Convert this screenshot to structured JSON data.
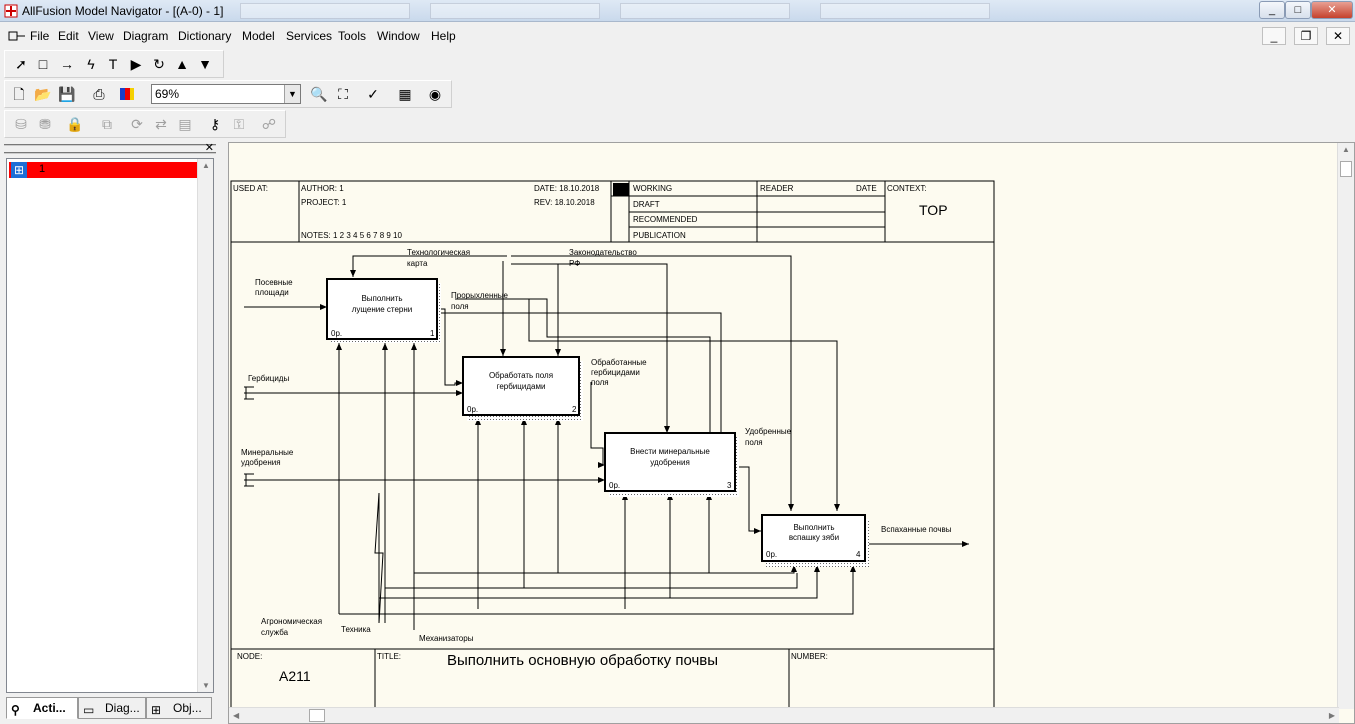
{
  "window": {
    "title": "AllFusion Model Navigator - [(A-0)  - 1]",
    "minimize": "_",
    "maximize": "□",
    "close": "✕"
  },
  "menu": [
    "File",
    "Edit",
    "View",
    "Diagram",
    "Dictionary",
    "Model",
    "Services",
    "Tools",
    "Window",
    "Help"
  ],
  "mdi_controls": {
    "minimize": "_",
    "restore": "❐",
    "close": "✕"
  },
  "toolbar": {
    "zoom_value": "69%"
  },
  "tree": {
    "root_label": "1"
  },
  "left_tabs": [
    "Acti...",
    "Diag...",
    "Obj..."
  ],
  "diagram": {
    "header": {
      "used_at": "USED AT:",
      "author": "AUTHOR:  1",
      "project": "PROJECT:  1",
      "notes": "NOTES:  1  2  3  4  5  6  7  8  9  10",
      "date": "DATE:  18.10.2018",
      "rev": "REV:   18.10.2018",
      "working": "WORKING",
      "draft": "DRAFT",
      "recommended": "RECOMMENDED",
      "publication": "PUBLICATION",
      "reader": "READER",
      "date2": "DATE",
      "context": "CONTEXT:",
      "top": "TOP"
    },
    "boxes": [
      {
        "label1": "Выполнить",
        "label2": "лущение стерни",
        "cost": "0р.",
        "num": "1"
      },
      {
        "label1": "Обработать поля",
        "label2": "гербицидами",
        "cost": "0р.",
        "num": "2"
      },
      {
        "label1": "Внести минеральные",
        "label2": "удобрения",
        "cost": "0р.",
        "num": "3"
      },
      {
        "label1": "Выполнить",
        "label2": "вспашку зяби",
        "cost": "0р.",
        "num": "4"
      }
    ],
    "arrows": {
      "posevnye1": "Посевные",
      "posevnye2": "площади",
      "gerbicidy": "Гербициды",
      "mineralnye1": "Минеральные",
      "mineralnye2": "удобрения",
      "tech1": "Технологическая",
      "tech2": "карта",
      "zakon1": "Законодательство",
      "zakon2": "РФ",
      "propol1": "Прорыхленные",
      "propol2": "поля",
      "obrab1": "Обработанные",
      "obrab2": "гербицидами",
      "obrab3": "поля",
      "udobr1": "Удобренные",
      "udobr2": "поля",
      "vspah": "Вспаханные почвы",
      "agro1": "Агрономическая",
      "agro2": "служба",
      "tehnika": "Техника",
      "mehan": "Механизаторы"
    },
    "footer": {
      "node": "NODE:",
      "node_value": "A211",
      "title_label": "TITLE:",
      "title_value": "Выполнить основную обработку почвы",
      "number_label": "NUMBER:"
    }
  }
}
